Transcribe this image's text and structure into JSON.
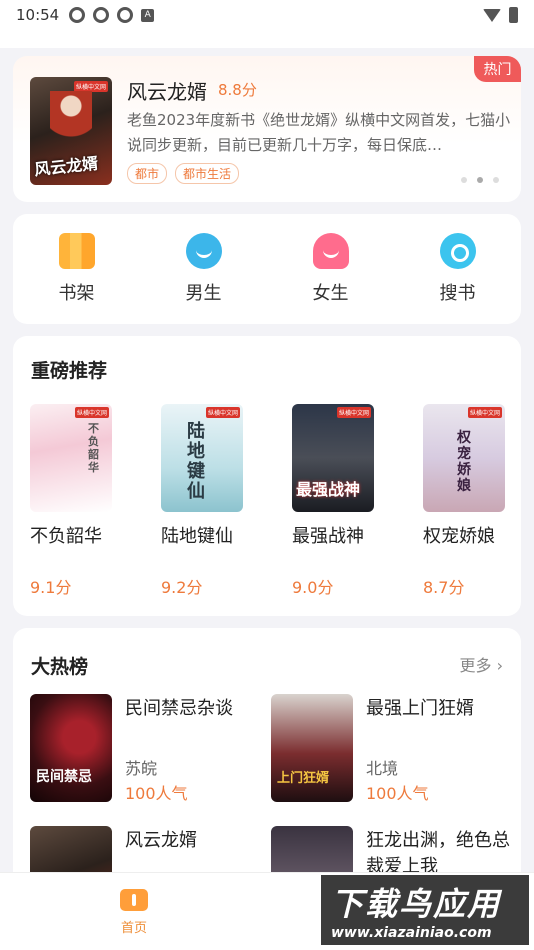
{
  "status_bar": {
    "time": "10:54",
    "badge": "A"
  },
  "banner": {
    "hot_label": "热门",
    "cover_title": "风云龙婿",
    "title": "风云龙婿",
    "score": "8.8分",
    "description": "老鱼2023年度新书《绝世龙婿》纵横中文网首发，七猫小说同步更新，目前已更新几十万字，每日保底…",
    "tags": [
      "都市",
      "都市生活"
    ],
    "page_count": 3,
    "active_page": 2
  },
  "shortcuts": [
    {
      "label": "书架",
      "icon": "bookshelf-icon"
    },
    {
      "label": "男生",
      "icon": "boy-icon"
    },
    {
      "label": "女生",
      "icon": "girl-icon"
    },
    {
      "label": "搜书",
      "icon": "search-icon"
    }
  ],
  "recommend": {
    "title": "重磅推荐",
    "books": [
      {
        "name": "不负韶华",
        "score": "9.1分",
        "cover_text": "不负韶华"
      },
      {
        "name": "陆地键仙",
        "score": "9.2分",
        "cover_text": "陆地键仙"
      },
      {
        "name": "最强战神",
        "score": "9.0分",
        "cover_text": "最强战神"
      },
      {
        "name": "权宠娇娘",
        "score": "8.7分",
        "cover_text": "权宠娇娘"
      }
    ]
  },
  "hotlist": {
    "title": "大热榜",
    "more": "更多 ›",
    "items": [
      {
        "name": "民间禁忌杂谈",
        "author": "苏皖",
        "popularity": "100人气",
        "cover_text": "民间禁忌"
      },
      {
        "name": "最强上门狂婿",
        "author": "北境",
        "popularity": "100人气",
        "cover_text": "上门狂婿"
      },
      {
        "name": "风云龙婿",
        "author": "",
        "popularity": "",
        "cover_text": ""
      },
      {
        "name": "狂龙出渊，绝色总裁爱上我",
        "author": "",
        "popularity": "",
        "cover_text": ""
      }
    ]
  },
  "bottom_nav": {
    "home_label": "首页"
  },
  "watermark": {
    "title": "下载鸟应用",
    "url": "www.xiazainiao.com"
  },
  "colors": {
    "accent": "#ee7a3c",
    "hot": "#ef5a5a",
    "nav_active": "#ff9e3a"
  }
}
